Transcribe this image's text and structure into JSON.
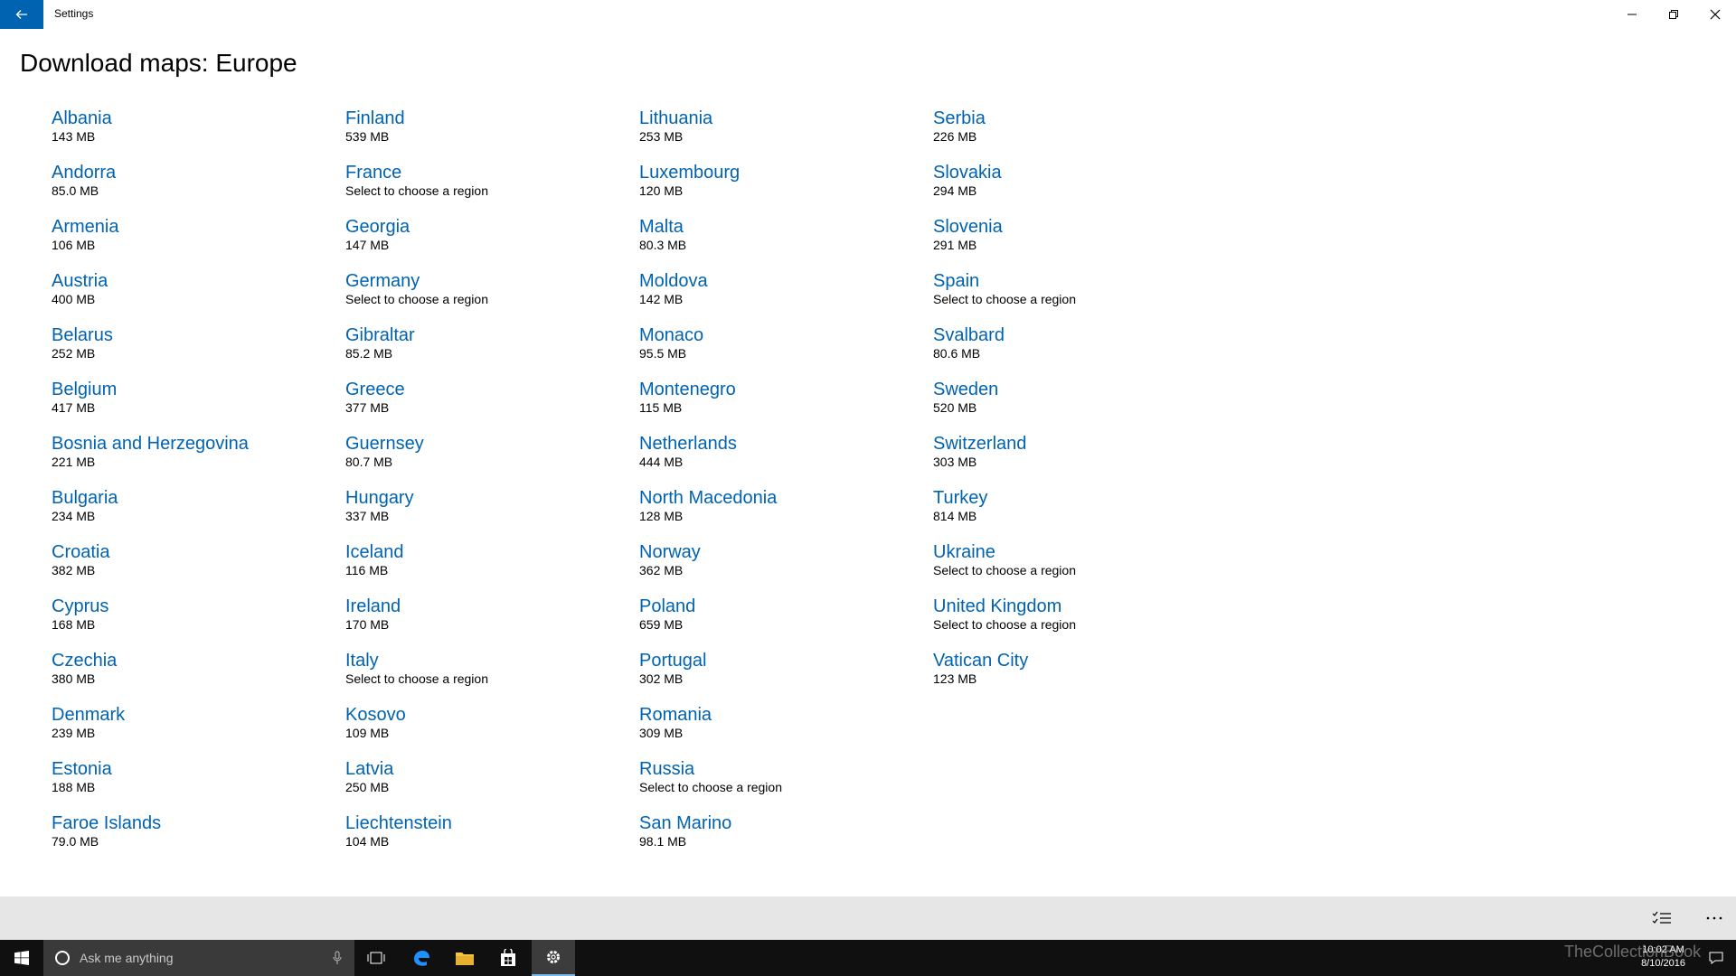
{
  "window": {
    "title": "Settings"
  },
  "page": {
    "title": "Download maps: Europe"
  },
  "columns": [
    [
      {
        "name": "Albania",
        "size": "143 MB"
      },
      {
        "name": "Andorra",
        "size": "85.0 MB"
      },
      {
        "name": "Armenia",
        "size": "106 MB"
      },
      {
        "name": "Austria",
        "size": "400 MB"
      },
      {
        "name": "Belarus",
        "size": "252 MB"
      },
      {
        "name": "Belgium",
        "size": "417 MB"
      },
      {
        "name": "Bosnia and Herzegovina",
        "size": "221 MB"
      },
      {
        "name": "Bulgaria",
        "size": "234 MB"
      },
      {
        "name": "Croatia",
        "size": "382 MB"
      },
      {
        "name": "Cyprus",
        "size": "168 MB"
      },
      {
        "name": "Czechia",
        "size": "380 MB"
      },
      {
        "name": "Denmark",
        "size": "239 MB"
      },
      {
        "name": "Estonia",
        "size": "188 MB"
      },
      {
        "name": "Faroe Islands",
        "size": "79.0 MB"
      }
    ],
    [
      {
        "name": "Finland",
        "size": "539 MB"
      },
      {
        "name": "France",
        "size": "Select to choose a region"
      },
      {
        "name": "Georgia",
        "size": "147 MB"
      },
      {
        "name": "Germany",
        "size": "Select to choose a region"
      },
      {
        "name": "Gibraltar",
        "size": "85.2 MB"
      },
      {
        "name": "Greece",
        "size": "377 MB"
      },
      {
        "name": "Guernsey",
        "size": "80.7 MB"
      },
      {
        "name": "Hungary",
        "size": "337 MB"
      },
      {
        "name": "Iceland",
        "size": "116 MB"
      },
      {
        "name": "Ireland",
        "size": "170 MB"
      },
      {
        "name": "Italy",
        "size": "Select to choose a region"
      },
      {
        "name": "Kosovo",
        "size": "109 MB"
      },
      {
        "name": "Latvia",
        "size": "250 MB"
      },
      {
        "name": "Liechtenstein",
        "size": "104 MB"
      }
    ],
    [
      {
        "name": "Lithuania",
        "size": "253 MB"
      },
      {
        "name": "Luxembourg",
        "size": "120 MB"
      },
      {
        "name": "Malta",
        "size": "80.3 MB"
      },
      {
        "name": "Moldova",
        "size": "142 MB"
      },
      {
        "name": "Monaco",
        "size": "95.5 MB"
      },
      {
        "name": "Montenegro",
        "size": "115 MB"
      },
      {
        "name": "Netherlands",
        "size": "444 MB"
      },
      {
        "name": "North Macedonia",
        "size": "128 MB"
      },
      {
        "name": "Norway",
        "size": "362 MB"
      },
      {
        "name": "Poland",
        "size": "659 MB"
      },
      {
        "name": "Portugal",
        "size": "302 MB"
      },
      {
        "name": "Romania",
        "size": "309 MB"
      },
      {
        "name": "Russia",
        "size": "Select to choose a region"
      },
      {
        "name": "San Marino",
        "size": "98.1 MB"
      }
    ],
    [
      {
        "name": "Serbia",
        "size": "226 MB"
      },
      {
        "name": "Slovakia",
        "size": "294 MB"
      },
      {
        "name": "Slovenia",
        "size": "291 MB"
      },
      {
        "name": "Spain",
        "size": "Select to choose a region"
      },
      {
        "name": "Svalbard",
        "size": "80.6 MB"
      },
      {
        "name": "Sweden",
        "size": "520 MB"
      },
      {
        "name": "Switzerland",
        "size": "303 MB"
      },
      {
        "name": "Turkey",
        "size": "814 MB"
      },
      {
        "name": "Ukraine",
        "size": "Select to choose a region"
      },
      {
        "name": "United Kingdom",
        "size": "Select to choose a region"
      },
      {
        "name": "Vatican City",
        "size": "123 MB"
      }
    ]
  ],
  "taskbar": {
    "search_placeholder": "Ask me anything",
    "time": "10:02 AM",
    "date": "8/10/2016"
  },
  "watermark": "TheCollectionBook",
  "colors": {
    "accent": "#0063b1",
    "link": "#0063b1",
    "taskbar": "#101010",
    "command_bar": "#e6e6e6"
  },
  "icons": {
    "back": "arrow-left-icon",
    "minimize": "minimize-icon",
    "restore": "restore-icon",
    "close": "close-icon",
    "list": "checklist-icon",
    "more": "more-icon",
    "start": "windows-logo-icon",
    "search": "cortana-circle-icon",
    "mic": "microphone-icon",
    "task_view": "task-view-icon",
    "edge": "edge-icon",
    "explorer": "folder-icon",
    "store": "store-icon",
    "settings": "gear-icon"
  }
}
